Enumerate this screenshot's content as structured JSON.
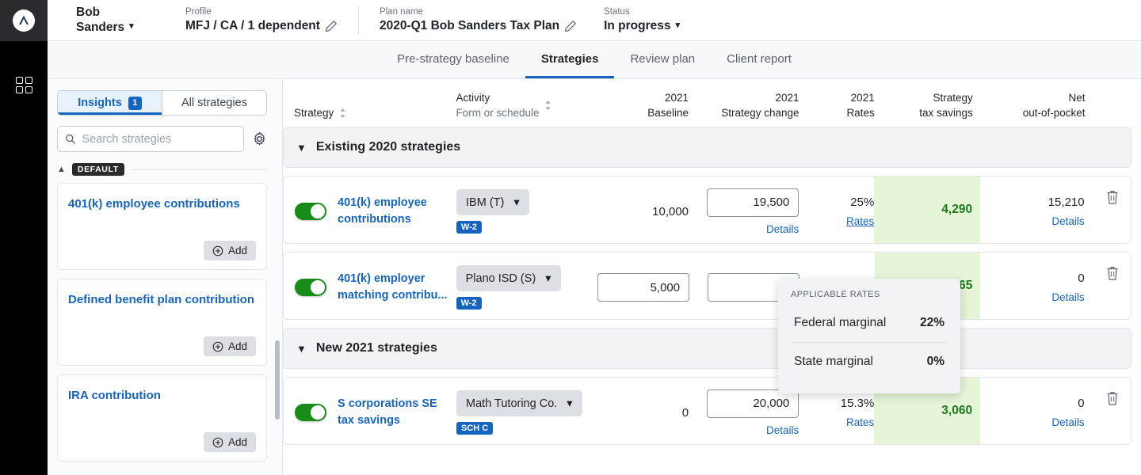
{
  "rail": {
    "logo_name": "corvee-logo",
    "items": [
      {
        "name": "dashboard-grid-icon"
      }
    ]
  },
  "header": {
    "client_first": "Bob",
    "client_last": "Sanders",
    "profile_label": "Profile",
    "profile_value": "MFJ / CA / 1 dependent",
    "plan_label": "Plan name",
    "plan_value": "2020-Q1 Bob Sanders Tax Plan",
    "status_label": "Status",
    "status_value": "In progress"
  },
  "tabs": [
    {
      "label": "Pre-strategy baseline",
      "active": false
    },
    {
      "label": "Strategies",
      "active": true
    },
    {
      "label": "Review plan",
      "active": false
    },
    {
      "label": "Client report",
      "active": false
    }
  ],
  "sidebar": {
    "segments": [
      {
        "label": "Insights",
        "badge": "1",
        "active": true
      },
      {
        "label": "All strategies",
        "badge": "",
        "active": false
      }
    ],
    "search_placeholder": "Search strategies",
    "search_value": "",
    "settings_icon": "gear-icon",
    "group_label": "DEFAULT",
    "cards": [
      {
        "title": "401(k) employee contributions",
        "action": "Add"
      },
      {
        "title": "Defined benefit plan contribution",
        "action": "Add"
      },
      {
        "title": "IRA contribution",
        "action": "Add"
      }
    ]
  },
  "table": {
    "headers": {
      "strategy": "Strategy",
      "activity": "Activity",
      "activity_sub": "Form or schedule",
      "baseline_top": "2021",
      "baseline_bottom": "Baseline",
      "change_top": "2021",
      "change_bottom": "Strategy change",
      "rates_top": "2021",
      "rates_bottom": "Rates",
      "savings_top": "Strategy",
      "savings_bottom": "tax savings",
      "net_top": "Net",
      "net_bottom": "out-of-pocket"
    },
    "sections": [
      {
        "title": "Existing 2020 strategies",
        "rows": [
          {
            "enabled": true,
            "strategy": "401(k) employee contributions",
            "activity": "IBM (T)",
            "form_badge": "W-2",
            "baseline": "10,000",
            "baseline_is_input": false,
            "change": "19,500",
            "change_is_input": true,
            "change_sublink": "Details",
            "rates": "25%",
            "rates_sublink": "Rates",
            "rates_sublink_underline": true,
            "savings": "4,290",
            "net": "15,210",
            "net_sublink": "Details",
            "delete_icon": "trash-icon"
          },
          {
            "enabled": true,
            "strategy": "401(k) employer matching contribu...",
            "activity": "Plano ISD (S)",
            "form_badge": "W-2",
            "baseline": "5,000",
            "baseline_is_input": true,
            "change": "",
            "change_is_input": true,
            "change_sublink": "",
            "rates": "",
            "rates_sublink": "",
            "rates_sublink_underline": false,
            "savings": "965",
            "net": "0",
            "net_sublink": "Details",
            "delete_icon": "trash-icon"
          }
        ]
      },
      {
        "title": "New 2021 strategies",
        "rows": [
          {
            "enabled": true,
            "strategy": "S corporations SE tax savings",
            "activity": "Math Tutoring Co.",
            "form_badge": "SCH C",
            "baseline": "0",
            "baseline_is_input": false,
            "change": "20,000",
            "change_is_input": true,
            "change_sublink": "Details",
            "rates": "15.3%",
            "rates_sublink": "Rates",
            "rates_sublink_underline": false,
            "savings": "3,060",
            "net": "0",
            "net_sublink": "Details",
            "delete_icon": "trash-icon"
          }
        ]
      }
    ]
  },
  "popover": {
    "title": "APPLICABLE RATES",
    "rows": [
      {
        "label": "Federal marginal",
        "value": "22%"
      },
      {
        "label": "State marginal",
        "value": "0%"
      }
    ]
  },
  "colors": {
    "accent_blue": "#1565c0",
    "toggle_green": "#188c19",
    "savings_green": "#1b7a1b",
    "savings_bg": "#e6f4d7",
    "rail_black": "#000000"
  }
}
